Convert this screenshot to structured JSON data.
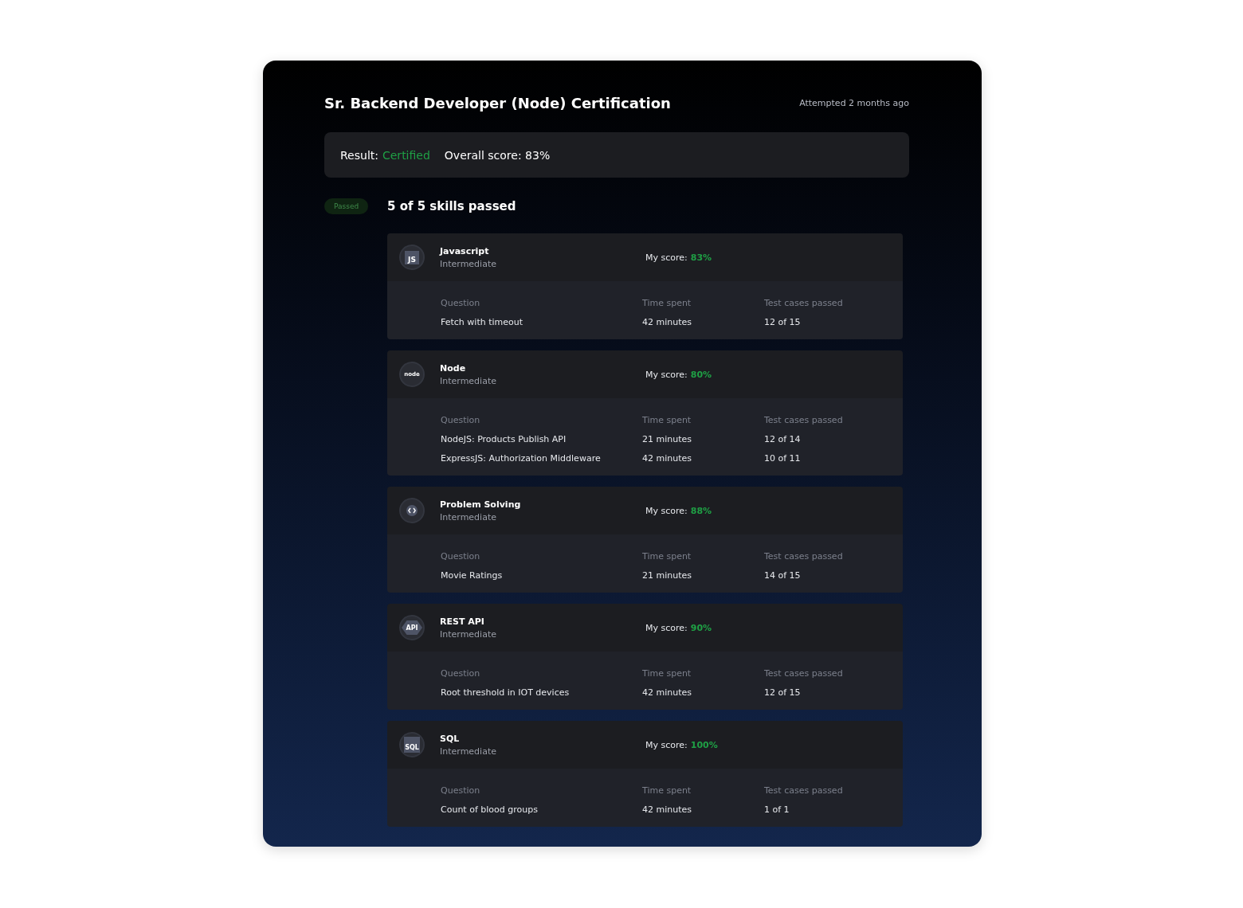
{
  "title": "Sr. Backend Developer (Node) Certification",
  "attempted": "Attempted 2 months ago",
  "result": {
    "label": "Result:",
    "value": "Certified",
    "score": "Overall score: 83%"
  },
  "skills_section": {
    "badge": "Passed",
    "heading": "5 of 5 skills passed"
  },
  "skills": [
    {
      "name": "Javascript",
      "level": "Intermediate",
      "kind": "js",
      "icon_text": "JS",
      "score_label": "My score:",
      "score": "83%",
      "columns": {
        "question": "Question",
        "time": "Time spent",
        "tests": "Test cases passed"
      },
      "questions": [
        {
          "title": "Fetch with timeout",
          "time": "42 minutes",
          "tests": "12 of 15"
        }
      ]
    },
    {
      "name": "Node",
      "level": "Intermediate",
      "kind": "node",
      "icon_text": "node",
      "score_label": "My score:",
      "score": "80%",
      "columns": {
        "question": "Question",
        "time": "Time spent",
        "tests": "Test cases passed"
      },
      "questions": [
        {
          "title": "NodeJS: Products Publish API",
          "time": "21 minutes",
          "tests": "12 of 14"
        },
        {
          "title": "ExpressJS: Authorization Middleware",
          "time": "42 minutes",
          "tests": "10 of 11"
        }
      ]
    },
    {
      "name": "Problem Solving",
      "level": "Intermediate",
      "kind": "code",
      "score_label": "My score:",
      "score": "88%",
      "columns": {
        "question": "Question",
        "time": "Time spent",
        "tests": "Test cases passed"
      },
      "questions": [
        {
          "title": "Movie Ratings",
          "time": "21 minutes",
          "tests": "14 of 15"
        }
      ]
    },
    {
      "name": "REST API",
      "level": "Intermediate",
      "kind": "api",
      "icon_text": "API",
      "score_label": "My score:",
      "score": "90%",
      "columns": {
        "question": "Question",
        "time": "Time spent",
        "tests": "Test cases passed"
      },
      "questions": [
        {
          "title": "Root threshold in IOT devices",
          "time": "42 minutes",
          "tests": "12 of 15"
        }
      ]
    },
    {
      "name": "SQL",
      "level": "Intermediate",
      "kind": "sql",
      "icon_text": "SQL",
      "score_label": "My score:",
      "score": "100%",
      "columns": {
        "question": "Question",
        "time": "Time spent",
        "tests": "Test cases passed"
      },
      "questions": [
        {
          "title": "Count of blood groups",
          "time": "42 minutes",
          "tests": "1 of 1"
        }
      ]
    }
  ]
}
